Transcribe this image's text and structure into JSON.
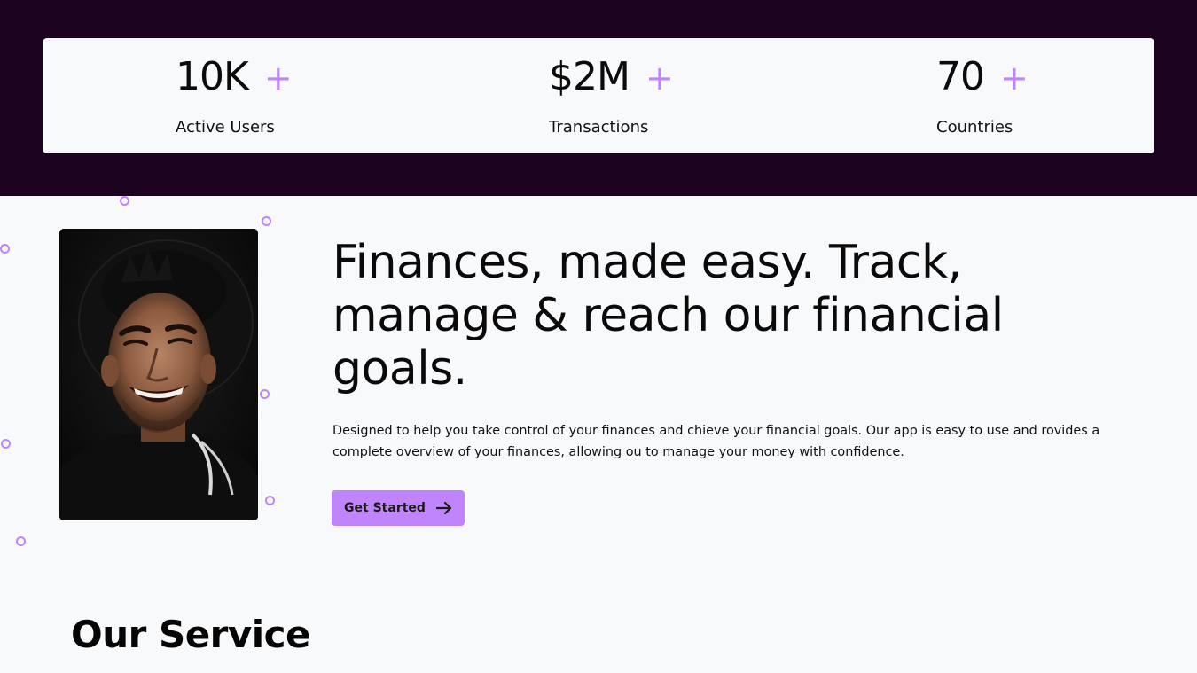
{
  "stats": [
    {
      "value": "10K",
      "plus": "+",
      "label": "Active Users"
    },
    {
      "value": "$2M",
      "plus": "+",
      "label": "Transactions"
    },
    {
      "value": "70",
      "plus": "+",
      "label": "Countries"
    }
  ],
  "hero": {
    "headline": "Finances, made easy. Track, manage & reach our financial goals.",
    "description": "Designed to help you take control of your finances and chieve your financial goals. Our app is easy to use and rovides a complete overview of your finances, allowing ou to manage your money with confidence.",
    "cta_label": "Get Started",
    "cta_icon": "arrow-right-icon",
    "image": "smiling-man-portrait"
  },
  "services": {
    "title": "Our Service"
  },
  "colors": {
    "dark_band": "#1c0421",
    "accent": "#c084fc",
    "page_bg": "#f8f9fb"
  }
}
